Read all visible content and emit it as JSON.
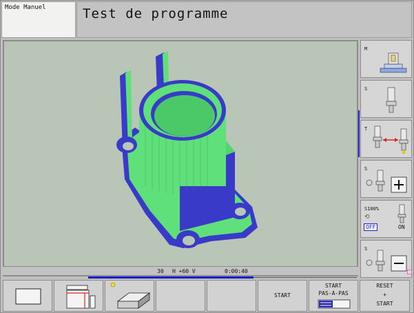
{
  "header": {
    "mode": "Mode Manuel",
    "title": "Test de programme"
  },
  "status": {
    "feed": "30",
    "spindle": "H +60 V",
    "time": "0:00:40"
  },
  "right_softkeys": [
    {
      "label": "M",
      "icon": "machine-icon"
    },
    {
      "label": "S",
      "icon": "spindle-tool-icon"
    },
    {
      "label": "T",
      "icon": "tool-change-icon"
    },
    {
      "label": "S",
      "icon": "spindle-plus-icon"
    },
    {
      "label": "S100%",
      "off": "OFF",
      "on": "ON",
      "icon": "spindle-override-icon"
    },
    {
      "label": "S",
      "icon": "spindle-minus-icon"
    }
  ],
  "bottom_softkeys": [
    {
      "icon": "window-icon"
    },
    {
      "icon": "split-view-icon"
    },
    {
      "icon": "workpiece-3d-icon"
    },
    {
      "label": ""
    },
    {
      "label": ""
    },
    {
      "label": "START"
    },
    {
      "label1": "START",
      "label2": "PAS-A-PAS",
      "icon": "single-step-icon"
    },
    {
      "label1": "RESET",
      "label2": "+",
      "label3": "START"
    }
  ],
  "colors": {
    "part_green": "#5fe07a",
    "part_blue": "#3a3ac8",
    "background": "#b9c6b7"
  }
}
